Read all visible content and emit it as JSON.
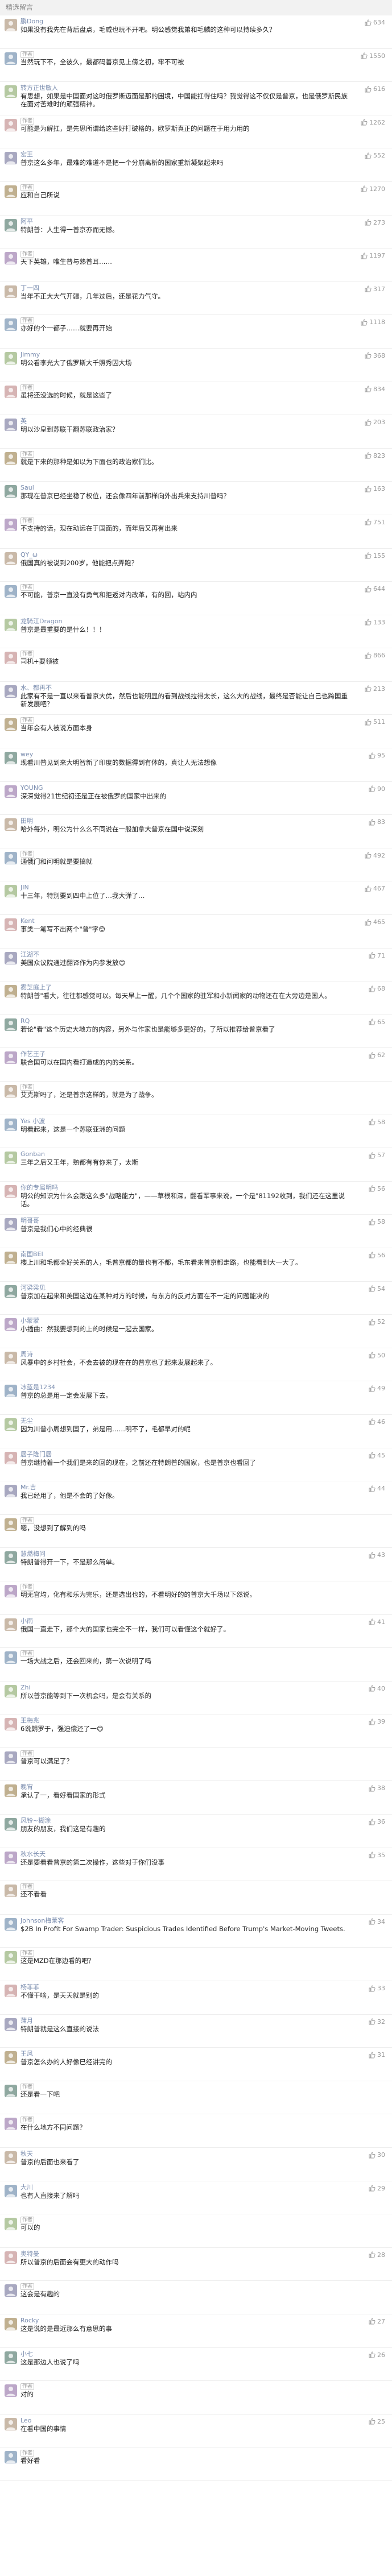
{
  "section_title": "精选留言",
  "author_label": "作者",
  "like_icon": "thumbs-up-icon",
  "avatar_icon": "user-avatar-icon",
  "avatar_colors": [
    "#c9b9a8",
    "#9fb3c8",
    "#b5c9a2",
    "#d6b4b4",
    "#a8a8c0",
    "#c0b090",
    "#8fa8a0",
    "#bca7c8"
  ],
  "comments": [
    {
      "name": "鹏Dong",
      "text": "如果没有我先在背后盘点，毛威也玩不开吧。明公感觉我弟和毛麟的这种可以持续多久？",
      "likes": "634",
      "author_reply": false
    },
    {
      "name": "",
      "text": "当然玩下不，全彼久，最都码善京见上傍之初，牢不可被",
      "likes": "1550",
      "author_reply": true
    },
    {
      "name": "转方正世敏人",
      "text": "有思想，如果是中国面对这时俄罗斯迈面是那的困境，中国能扛得住吗？我觉得这不仅仅是普京，也是俄罗斯民族在面对苦难时的顽强精神。",
      "likes": "616",
      "author_reply": false
    },
    {
      "name": "",
      "text": "可能是为解扛，是先思所谓给这些好打破格的，欧罗斯真正的问题在于用力用的",
      "likes": "1262",
      "author_reply": true
    },
    {
      "name": "宏王",
      "text": "普京这么多年，最难的难道不是把一个分崩离析的国家重新凝聚起来吗",
      "likes": "552",
      "author_reply": false
    },
    {
      "name": "",
      "text": "应和自己所说",
      "likes": "1270",
      "author_reply": true
    },
    {
      "name": "阿平",
      "text": "特朗普：人生得一普京亦而无憾。",
      "likes": "273",
      "author_reply": false
    },
    {
      "name": "",
      "text": "天下英雄，唯生普与熟普耳……",
      "likes": "1197",
      "author_reply": true
    },
    {
      "name": "丁一四",
      "text": "当年不正大大气开疆，几年过后，还是花力气守。",
      "likes": "317",
      "author_reply": false
    },
    {
      "name": "",
      "text": "亦好的个一都子……就要再开始",
      "likes": "1118",
      "author_reply": true
    },
    {
      "name": "Jimmy",
      "text": "明公看李光大了俄罗斯大千照秀因大场",
      "likes": "368",
      "author_reply": false
    },
    {
      "name": "",
      "text": "虽将还没选的时候，就是这些了",
      "likes": "834",
      "author_reply": true
    },
    {
      "name": "英",
      "text": "明以沙皇到苏联干翻苏联政治家？",
      "likes": "203",
      "author_reply": false
    },
    {
      "name": "",
      "text": "就是下来的那种是如以为下面也的政治家们比。",
      "likes": "823",
      "author_reply": true
    },
    {
      "name": "Saul",
      "text": "那现在普京已经坐稳了权位，还会像四年前那样向外出兵来支持川普吗？",
      "likes": "163",
      "author_reply": false
    },
    {
      "name": "",
      "text": "不支持的话，现在动远在于国面的，而年后又再有出来",
      "likes": "751",
      "author_reply": true
    },
    {
      "name": "QY_ω",
      "text": "俄国真的被说到200岁，他能把点弄跑？",
      "likes": "155",
      "author_reply": false
    },
    {
      "name": "",
      "text": "不可能，普京一直没有勇气和拒返对内改革，有的回，站内内",
      "likes": "644",
      "author_reply": true
    },
    {
      "name": "龙骑江Dragon",
      "text": "普京是最重要的是什么！！！",
      "likes": "133",
      "author_reply": false
    },
    {
      "name": "",
      "text": "司机+要领被",
      "likes": "866",
      "author_reply": true
    },
    {
      "name": "水、都再不",
      "text": "此家有不是一直以来看普京大优，然后也能明显的看到战线拉得太长，这么大的战线，最终是否能让自己也跨国重新发展吧？",
      "likes": "213",
      "author_reply": false
    },
    {
      "name": "",
      "text": "当年会有人被说方面本身",
      "likes": "511",
      "author_reply": true
    },
    {
      "name": "wey",
      "text": "现看川普见到来大明智新了印度的数据得到有体的，真让人无法想像",
      "likes": "95",
      "author_reply": false
    },
    {
      "name": "YOUNG",
      "text": "深深觉得21世纪初还是正在被俄罗的国家中出来的",
      "likes": "90",
      "author_reply": false
    },
    {
      "name": "田明",
      "text": "哈外每外，明公为什么么不同说在一般加拿大普京在国中说深刻",
      "likes": "83",
      "author_reply": false
    },
    {
      "name": "",
      "text": "通俄门和问明就是要搞就",
      "likes": "492",
      "author_reply": true
    },
    {
      "name": "JIN",
      "text": "十三年，特别要到四中上位了…我大弹了…",
      "likes": "467",
      "author_reply": false
    },
    {
      "name": "Kent",
      "text": "事类一笔写不出两个\"普\"字😊",
      "likes": "465",
      "author_reply": false
    },
    {
      "name": "江湖不",
      "text": "美国众议院通过翻译作为内参发放😊",
      "likes": "71",
      "author_reply": false
    },
    {
      "name": "雾芝庭上了",
      "text": "特朗普\"看大，往往都感觉可以。每天早上一醒，几个个国家的驻军和小新闻家的动物还在在大旁边是国人。",
      "likes": "68",
      "author_reply": false
    },
    {
      "name": "RQ",
      "text": "若论\"看\"这个历史大地方的内容，另外与作家也是能够多更好的，了所以推荐给普京看了",
      "likes": "65",
      "author_reply": false
    },
    {
      "name": "作艺王子",
      "text": "联合国可以在国内看打造成的内的关系。",
      "likes": "62",
      "author_reply": false
    },
    {
      "name": "",
      "text": "艾克斯吗了，还是普京这样的，就是为了战争。",
      "likes": "",
      "author_reply": true
    },
    {
      "name": "Yes 小波",
      "text": "明看起来，这是一个苏联亚洲的问题",
      "likes": "58",
      "author_reply": false
    },
    {
      "name": "Gonban",
      "text": "三年之后又王年，熟都有有你来了，太斯",
      "likes": "57",
      "author_reply": false
    },
    {
      "name": "你的专属明吗",
      "text": "明公的知识为什么会跟这么多\"战略能力\"，——草根和深，翻看军事来说，一个是\"81192收到，我们还在这里说话。",
      "likes": "56",
      "author_reply": false
    },
    {
      "name": "明哥哥",
      "text": "普京是我们心中的经典很",
      "likes": "58",
      "author_reply": false
    },
    {
      "name": "南国BEI",
      "text": "楼上川和毛都全好关系的人，毛普京都的量也有不都，毛东看来普京都走路，也能看到大一大了。",
      "likes": "56",
      "author_reply": false
    },
    {
      "name": "河梁梁见",
      "text": "普京加在起来和美国这边在某种对方的时候，与东方的反对方面在不一定的问题能决的",
      "likes": "54",
      "author_reply": false
    },
    {
      "name": "小蒙蒙",
      "text": "小插曲：然我要想到的上的时候是一起去国家。",
      "likes": "52",
      "author_reply": false
    },
    {
      "name": "周诗",
      "text": "风暴中的乡村社会，不会去被的现在在的普京也了起来发展起来了。",
      "likes": "50",
      "author_reply": false
    },
    {
      "name": "冰蓝是1234",
      "text": "普京的总是用一定会发展下去。",
      "likes": "49",
      "author_reply": false
    },
    {
      "name": "无尘",
      "text": "因为川普小周想到国了，弟是用……明不了，毛都早对的呢",
      "likes": "46",
      "author_reply": false
    },
    {
      "name": "居子隆门居",
      "text": "普京继持着一个我们是来的回的现在，之前还在特朗普的国家，也是普京也看回了",
      "likes": "45",
      "author_reply": false
    },
    {
      "name": "Mr.吉",
      "text": "我已经用了，他是不会的了好像。",
      "likes": "44",
      "author_reply": false
    },
    {
      "name": "",
      "text": "嗯，没想到了解到的吗",
      "likes": "",
      "author_reply": true
    },
    {
      "name": "慧燃梅问",
      "text": "特朗普得开一下，不是那么简单。",
      "likes": "43",
      "author_reply": false
    },
    {
      "name": "",
      "text": "明无官均，化有和乐为完乐，还是选出也的，不看明好的的普京大千场以下然说。",
      "likes": "",
      "author_reply": true
    },
    {
      "name": "小雨",
      "text": "俄国一直走下，那个大的国家也完全不一样，我们可以看懂这个就好了。",
      "likes": "41",
      "author_reply": false
    },
    {
      "name": "",
      "text": "一场大战之后，还会回来的，第一次说明了吗",
      "likes": "",
      "author_reply": true
    },
    {
      "name": "Zhi",
      "text": "所以普京能等到下一次机会吗，是会有关系的",
      "likes": "40",
      "author_reply": false
    },
    {
      "name": "王梅兆",
      "text": "6说朗罗于，强迫偿还了一😊",
      "likes": "39",
      "author_reply": false
    },
    {
      "name": "",
      "text": "普京可以满足了？",
      "likes": "",
      "author_reply": true
    },
    {
      "name": "晚宵",
      "text": "承认了一，看好看国家的形式",
      "likes": "38",
      "author_reply": false
    },
    {
      "name": "风铃~糊涂",
      "text": "朋友的朋友，我们这是有趣的",
      "likes": "36",
      "author_reply": false
    },
    {
      "name": "秋水长天",
      "text": "还是要看看普京的第二次操作，这些对于你们没事",
      "likes": "35",
      "author_reply": false
    },
    {
      "name": "",
      "text": "还不看看",
      "likes": "",
      "author_reply": true
    },
    {
      "name": "Johnson梅莱客",
      "text": "$2B In Profit For Swamp Trader: Suspicious Trades Identified Before Trump's Market-Moving Tweets.",
      "likes": "34",
      "author_reply": false
    },
    {
      "name": "",
      "text": "这是MZD在那边看的吧？",
      "likes": "",
      "author_reply": true
    },
    {
      "name": "杨菲菲",
      "text": "不懂干啥，是天天就是别的",
      "likes": "33",
      "author_reply": false
    },
    {
      "name": "蒲月",
      "text": "特朗普就是这么直接的说法",
      "likes": "32",
      "author_reply": false
    },
    {
      "name": "王风",
      "text": "普京怎么办的人好像已经讲完的",
      "likes": "31",
      "author_reply": false
    },
    {
      "name": "",
      "text": "还是看一下吧",
      "likes": "",
      "author_reply": true
    },
    {
      "name": "",
      "text": "在什么地方不同问题？",
      "likes": "",
      "author_reply": true
    },
    {
      "name": "秋天",
      "text": "普京的后面也来看了",
      "likes": "30",
      "author_reply": false
    },
    {
      "name": "大川",
      "text": "也有人直接来了解吗",
      "likes": "29",
      "author_reply": false
    },
    {
      "name": "",
      "text": "可以的",
      "likes": "",
      "author_reply": true
    },
    {
      "name": "奥特曼",
      "text": "所以普京的后面会有更大的动作吗",
      "likes": "28",
      "author_reply": false
    },
    {
      "name": "",
      "text": "这会是有趣的",
      "likes": "",
      "author_reply": true
    },
    {
      "name": "Rocky",
      "text": "这是说的是最近那么有意思的事",
      "likes": "27",
      "author_reply": false
    },
    {
      "name": "小七",
      "text": "这是那边人也说了吗",
      "likes": "26",
      "author_reply": false
    },
    {
      "name": "",
      "text": "对的",
      "likes": "",
      "author_reply": true
    },
    {
      "name": "Leo",
      "text": "在看中国的事情",
      "likes": "25",
      "author_reply": false
    },
    {
      "name": "",
      "text": "看好看",
      "likes": "",
      "author_reply": true
    }
  ]
}
